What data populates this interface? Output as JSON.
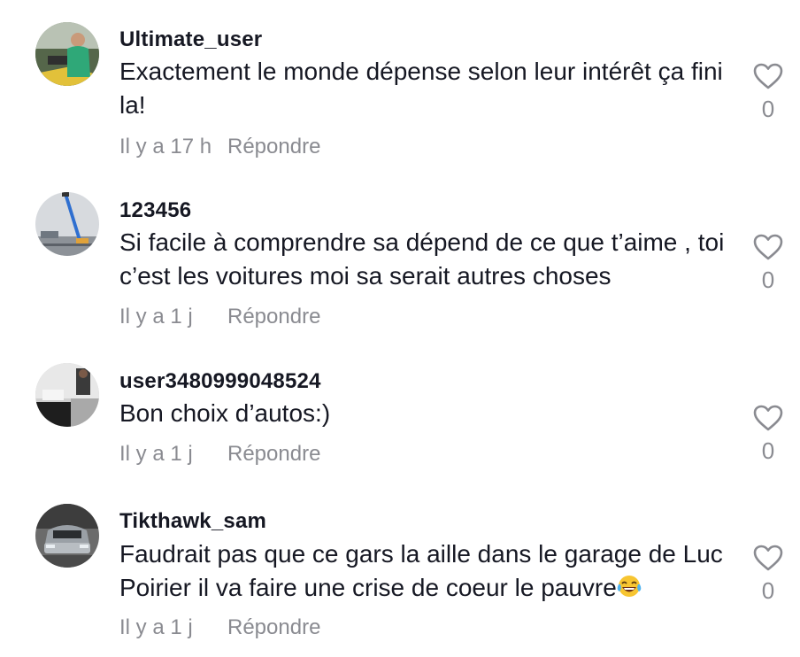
{
  "comments": [
    {
      "username": "Ultimate_user",
      "text": "Exactement le monde dépense selon leur intérêt ça fini la!",
      "time": "Il y a 17 h",
      "reply_label": "Répondre",
      "likes": "0",
      "avatar_icon": "person-on-boat-avatar"
    },
    {
      "username": "123456",
      "text": "Si facile à comprendre sa dépend de ce que t’aime , toi c’est les voitures moi sa serait autres choses",
      "time": "Il y a 1 j",
      "reply_label": "Répondre",
      "likes": "0",
      "avatar_icon": "crane-avatar"
    },
    {
      "username": "user3480999048524",
      "text": "Bon choix d’autos:)",
      "time": "Il y a 1 j",
      "reply_label": "Répondre",
      "likes": "0",
      "avatar_icon": "room-photo-avatar"
    },
    {
      "username": "Tikthawk_sam",
      "text": "Faudrait pas que ce gars la aille dans le garage de Luc Poirier il va faire une crise de coeur le pauvre",
      "text_emoji": "laughing-tears-emoji",
      "time": "Il y a 1 j",
      "reply_label": "Répondre",
      "likes": "0",
      "avatar_icon": "car-avatar"
    }
  ],
  "colors": {
    "text": "#161823",
    "muted": "#8a8b91",
    "heart": "#8a8b91"
  }
}
